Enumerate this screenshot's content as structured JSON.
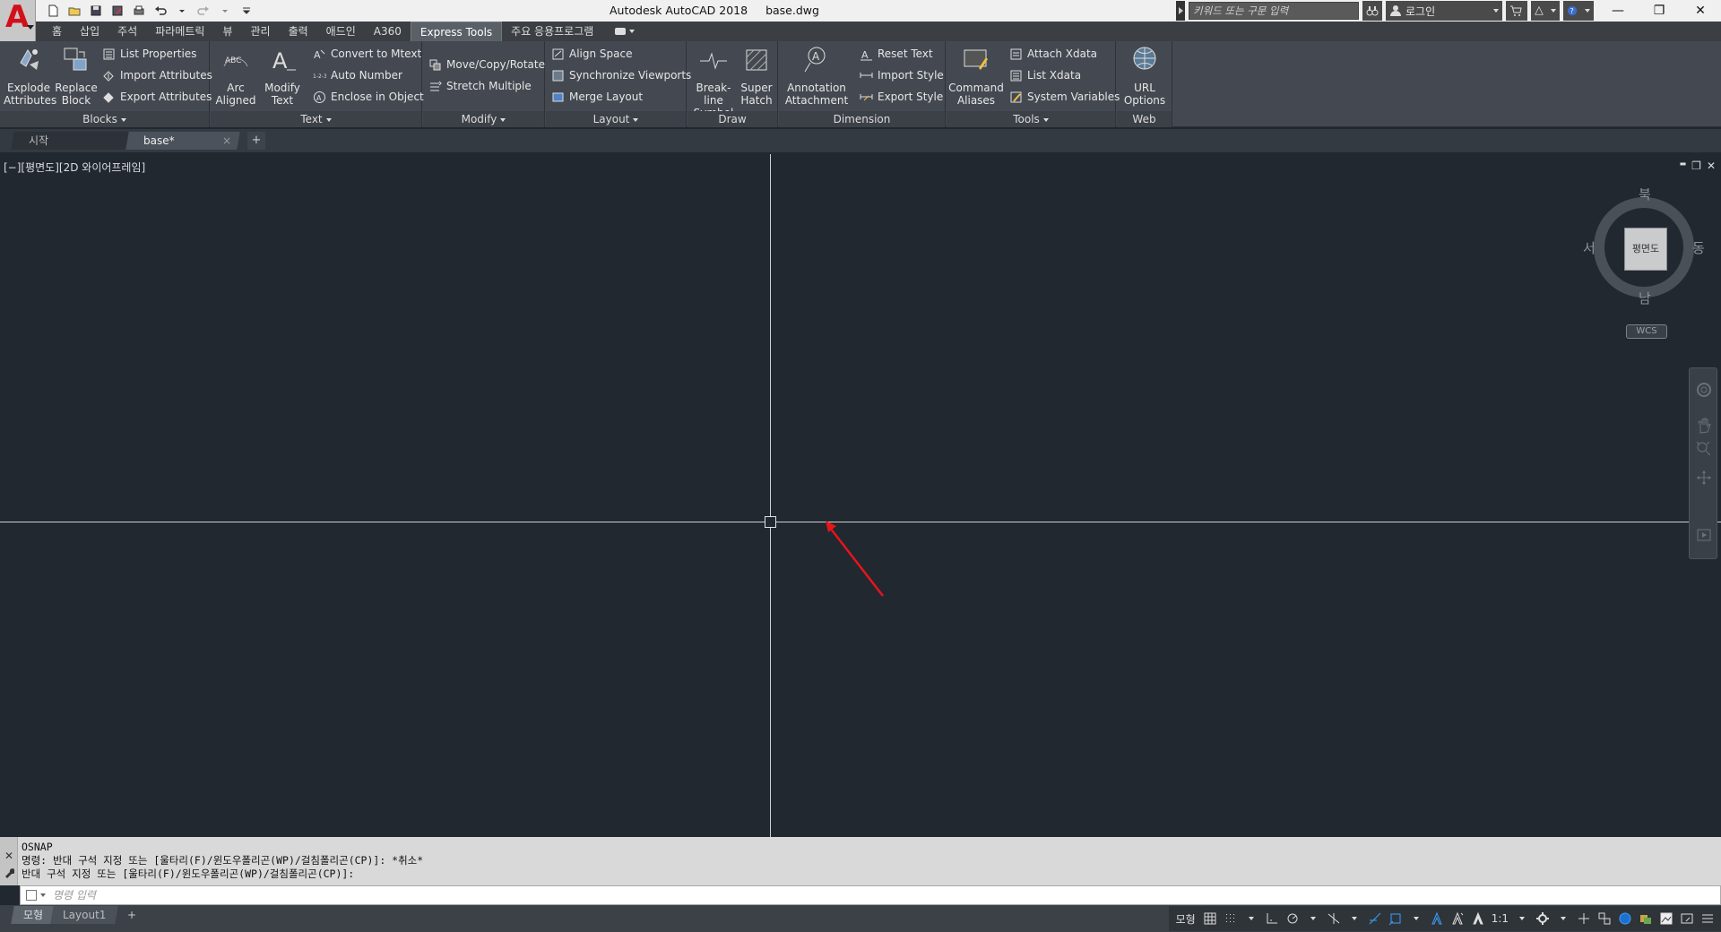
{
  "title": {
    "app": "Autodesk AutoCAD 2018",
    "file": "base.dwg"
  },
  "search": {
    "placeholder": "키워드 또는 구문 입력"
  },
  "user": {
    "login_label": "로그인"
  },
  "ribbon_tabs": [
    "홈",
    "삽입",
    "주석",
    "파라메트릭",
    "뷰",
    "관리",
    "출력",
    "애드인",
    "A360",
    "Express Tools",
    "주요 응용프로그램"
  ],
  "active_tab": "Express Tools",
  "panels": {
    "blocks": {
      "title": "Blocks",
      "explode_attributes": "Explode\nAttributes",
      "replace_block": "Replace\nBlock",
      "list_properties": "List Properties",
      "import_attributes": "Import Attributes",
      "export_attributes": "Export Attributes"
    },
    "text": {
      "title": "Text",
      "arc_aligned": "Arc\nAligned",
      "modify_text": "Modify\nText",
      "convert_to_mtext": "Convert to Mtext",
      "auto_number": "Auto Number",
      "enclose_in_object": "Enclose in Object"
    },
    "modify": {
      "title": "Modify",
      "move_copy_rotate": "Move/Copy/Rotate",
      "stretch_multiple": "Stretch Multiple"
    },
    "layout": {
      "title": "Layout",
      "align_space": "Align Space",
      "synchronize_viewports": "Synchronize Viewports",
      "merge_layout": "Merge Layout"
    },
    "draw": {
      "title": "Draw",
      "break_line_symbol": "Break-line\nSymbol",
      "super_hatch": "Super\nHatch"
    },
    "dimension": {
      "title": "Dimension",
      "annotation_attachment": "Annotation\nAttachment",
      "reset_text": "Reset Text",
      "import_style": "Import Style",
      "export_style": "Export Style"
    },
    "tools": {
      "title": "Tools",
      "command_aliases": "Command\nAliases",
      "attach_xdata": "Attach Xdata",
      "list_xdata": "List Xdata",
      "system_variables": "System Variables"
    },
    "web": {
      "title": "Web",
      "url_options": "URL\nOptions"
    }
  },
  "file_tabs": {
    "start": "시작",
    "current": "base*",
    "close": "×",
    "add": "+"
  },
  "viewport": {
    "label": "[−][평면도][2D 와이어프레임]",
    "controls": [
      "▬",
      "❐",
      "✕"
    ]
  },
  "viewcube": {
    "face": "평면도",
    "north": "북",
    "south": "남",
    "east": "동",
    "west": "서",
    "wcs": "WCS"
  },
  "command": {
    "history": [
      "OSNAP",
      "명령: 반대 구석 지정 또는 [울타리(F)/윈도우폴리곤(WP)/걸침폴리곤(CP)]: *취소*",
      "반대 구석 지정 또는 [울타리(F)/윈도우폴리곤(WP)/걸침폴리곤(CP)]:"
    ],
    "placeholder": "명령 입력"
  },
  "layout_tabs": {
    "model": "모형",
    "layout1": "Layout1",
    "add": "+"
  },
  "status": {
    "model_label": "모형",
    "scale": "1:1"
  },
  "colors": {
    "viewport_bg": "#212830",
    "ribbon_bg": "#444951",
    "arrow": "#e8141b",
    "snap_on": "#3aa0ff"
  }
}
